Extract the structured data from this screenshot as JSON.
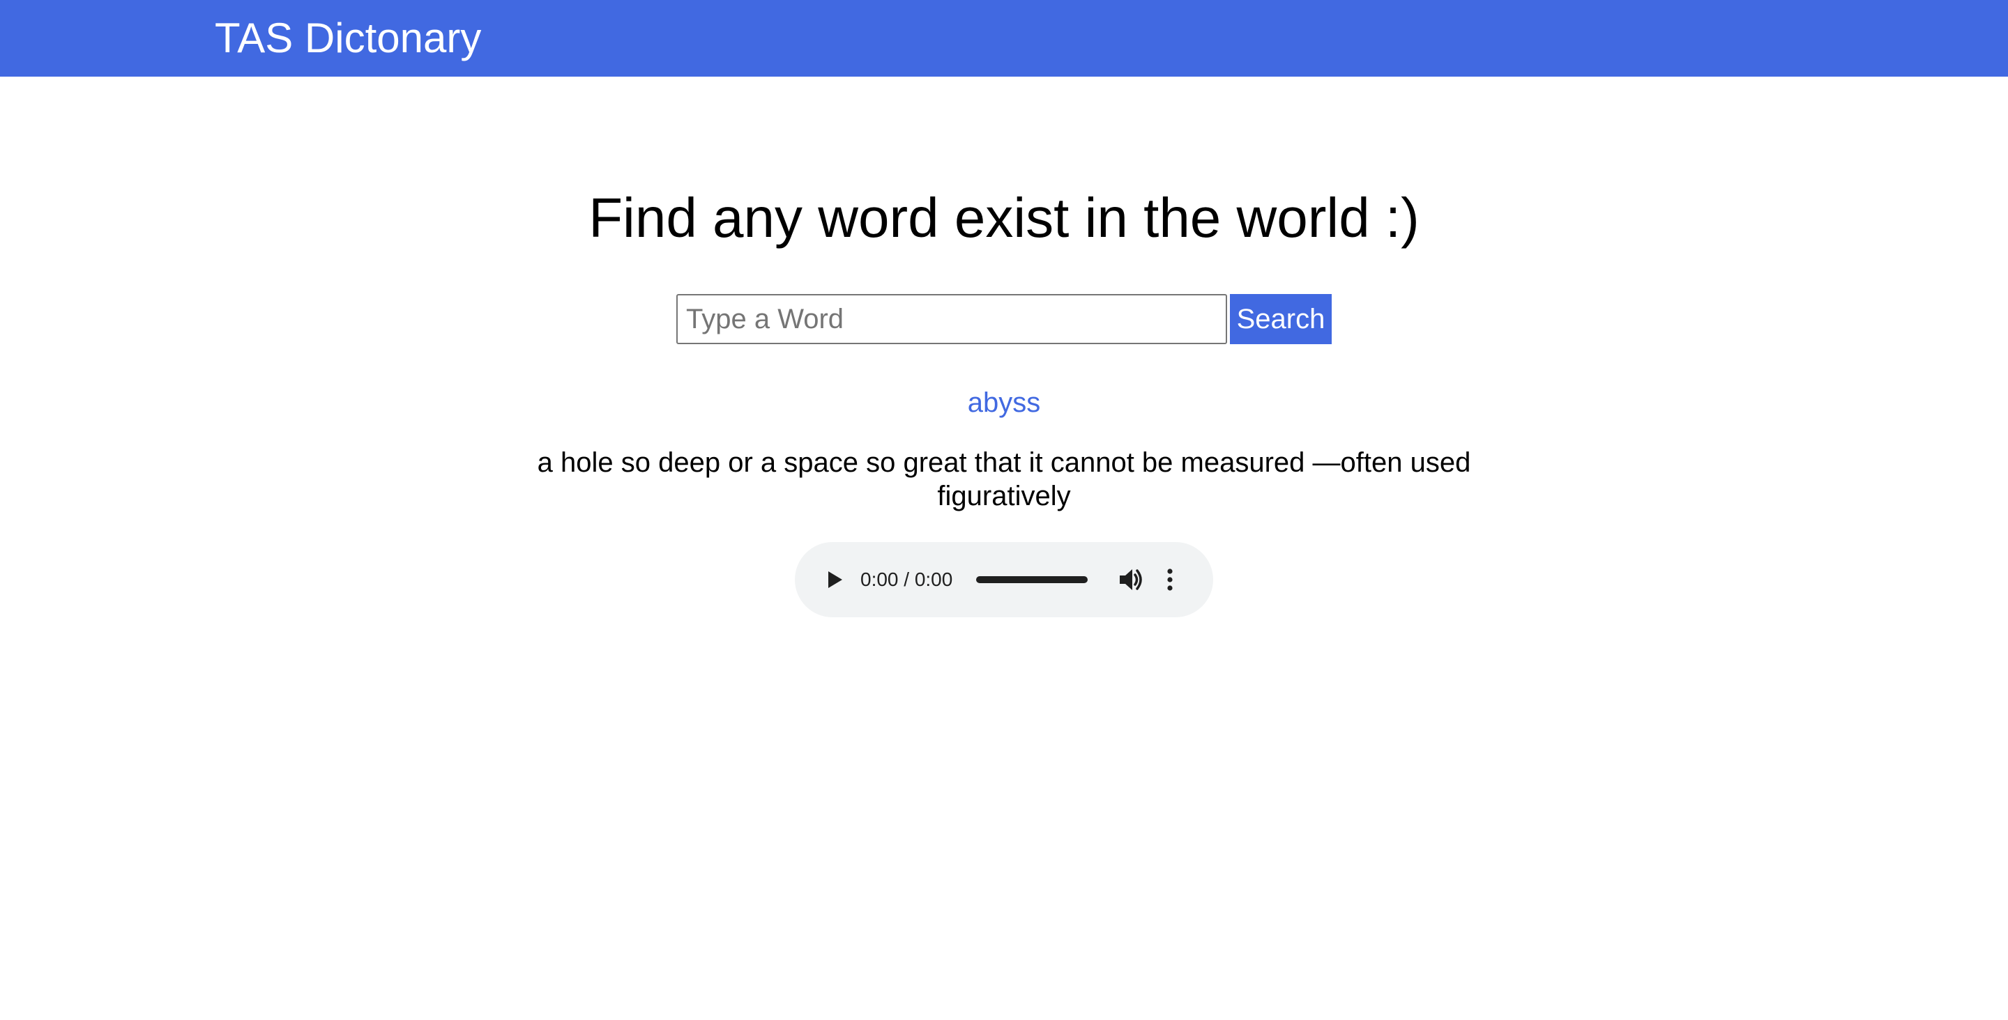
{
  "header": {
    "brand": "TAS Dictonary",
    "bar_color": "#4169e1"
  },
  "main": {
    "headline": "Find any word exist in the world :)",
    "search": {
      "placeholder": "Type a Word",
      "value": "",
      "button_label": "Search"
    },
    "result": {
      "word": "abyss",
      "definition": "a hole so deep or a space so great that it cannot be measured —often used figuratively"
    },
    "audio_player": {
      "time": "0:00 / 0:00",
      "progress": 0,
      "icons": [
        "play-icon",
        "volume-icon",
        "more-options-icon"
      ]
    }
  }
}
